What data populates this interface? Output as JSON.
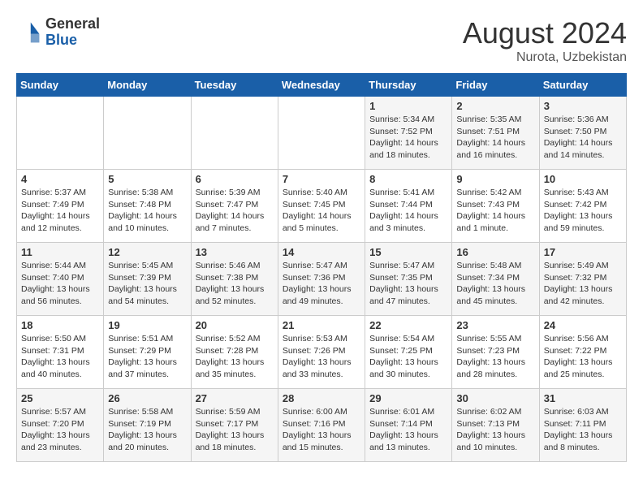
{
  "header": {
    "logo_general": "General",
    "logo_blue": "Blue",
    "month_year": "August 2024",
    "location": "Nurota, Uzbekistan"
  },
  "days_of_week": [
    "Sunday",
    "Monday",
    "Tuesday",
    "Wednesday",
    "Thursday",
    "Friday",
    "Saturday"
  ],
  "weeks": [
    [
      {
        "day": "",
        "info": ""
      },
      {
        "day": "",
        "info": ""
      },
      {
        "day": "",
        "info": ""
      },
      {
        "day": "",
        "info": ""
      },
      {
        "day": "1",
        "info": "Sunrise: 5:34 AM\nSunset: 7:52 PM\nDaylight: 14 hours\nand 18 minutes."
      },
      {
        "day": "2",
        "info": "Sunrise: 5:35 AM\nSunset: 7:51 PM\nDaylight: 14 hours\nand 16 minutes."
      },
      {
        "day": "3",
        "info": "Sunrise: 5:36 AM\nSunset: 7:50 PM\nDaylight: 14 hours\nand 14 minutes."
      }
    ],
    [
      {
        "day": "4",
        "info": "Sunrise: 5:37 AM\nSunset: 7:49 PM\nDaylight: 14 hours\nand 12 minutes."
      },
      {
        "day": "5",
        "info": "Sunrise: 5:38 AM\nSunset: 7:48 PM\nDaylight: 14 hours\nand 10 minutes."
      },
      {
        "day": "6",
        "info": "Sunrise: 5:39 AM\nSunset: 7:47 PM\nDaylight: 14 hours\nand 7 minutes."
      },
      {
        "day": "7",
        "info": "Sunrise: 5:40 AM\nSunset: 7:45 PM\nDaylight: 14 hours\nand 5 minutes."
      },
      {
        "day": "8",
        "info": "Sunrise: 5:41 AM\nSunset: 7:44 PM\nDaylight: 14 hours\nand 3 minutes."
      },
      {
        "day": "9",
        "info": "Sunrise: 5:42 AM\nSunset: 7:43 PM\nDaylight: 14 hours\nand 1 minute."
      },
      {
        "day": "10",
        "info": "Sunrise: 5:43 AM\nSunset: 7:42 PM\nDaylight: 13 hours\nand 59 minutes."
      }
    ],
    [
      {
        "day": "11",
        "info": "Sunrise: 5:44 AM\nSunset: 7:40 PM\nDaylight: 13 hours\nand 56 minutes."
      },
      {
        "day": "12",
        "info": "Sunrise: 5:45 AM\nSunset: 7:39 PM\nDaylight: 13 hours\nand 54 minutes."
      },
      {
        "day": "13",
        "info": "Sunrise: 5:46 AM\nSunset: 7:38 PM\nDaylight: 13 hours\nand 52 minutes."
      },
      {
        "day": "14",
        "info": "Sunrise: 5:47 AM\nSunset: 7:36 PM\nDaylight: 13 hours\nand 49 minutes."
      },
      {
        "day": "15",
        "info": "Sunrise: 5:47 AM\nSunset: 7:35 PM\nDaylight: 13 hours\nand 47 minutes."
      },
      {
        "day": "16",
        "info": "Sunrise: 5:48 AM\nSunset: 7:34 PM\nDaylight: 13 hours\nand 45 minutes."
      },
      {
        "day": "17",
        "info": "Sunrise: 5:49 AM\nSunset: 7:32 PM\nDaylight: 13 hours\nand 42 minutes."
      }
    ],
    [
      {
        "day": "18",
        "info": "Sunrise: 5:50 AM\nSunset: 7:31 PM\nDaylight: 13 hours\nand 40 minutes."
      },
      {
        "day": "19",
        "info": "Sunrise: 5:51 AM\nSunset: 7:29 PM\nDaylight: 13 hours\nand 37 minutes."
      },
      {
        "day": "20",
        "info": "Sunrise: 5:52 AM\nSunset: 7:28 PM\nDaylight: 13 hours\nand 35 minutes."
      },
      {
        "day": "21",
        "info": "Sunrise: 5:53 AM\nSunset: 7:26 PM\nDaylight: 13 hours\nand 33 minutes."
      },
      {
        "day": "22",
        "info": "Sunrise: 5:54 AM\nSunset: 7:25 PM\nDaylight: 13 hours\nand 30 minutes."
      },
      {
        "day": "23",
        "info": "Sunrise: 5:55 AM\nSunset: 7:23 PM\nDaylight: 13 hours\nand 28 minutes."
      },
      {
        "day": "24",
        "info": "Sunrise: 5:56 AM\nSunset: 7:22 PM\nDaylight: 13 hours\nand 25 minutes."
      }
    ],
    [
      {
        "day": "25",
        "info": "Sunrise: 5:57 AM\nSunset: 7:20 PM\nDaylight: 13 hours\nand 23 minutes."
      },
      {
        "day": "26",
        "info": "Sunrise: 5:58 AM\nSunset: 7:19 PM\nDaylight: 13 hours\nand 20 minutes."
      },
      {
        "day": "27",
        "info": "Sunrise: 5:59 AM\nSunset: 7:17 PM\nDaylight: 13 hours\nand 18 minutes."
      },
      {
        "day": "28",
        "info": "Sunrise: 6:00 AM\nSunset: 7:16 PM\nDaylight: 13 hours\nand 15 minutes."
      },
      {
        "day": "29",
        "info": "Sunrise: 6:01 AM\nSunset: 7:14 PM\nDaylight: 13 hours\nand 13 minutes."
      },
      {
        "day": "30",
        "info": "Sunrise: 6:02 AM\nSunset: 7:13 PM\nDaylight: 13 hours\nand 10 minutes."
      },
      {
        "day": "31",
        "info": "Sunrise: 6:03 AM\nSunset: 7:11 PM\nDaylight: 13 hours\nand 8 minutes."
      }
    ]
  ]
}
